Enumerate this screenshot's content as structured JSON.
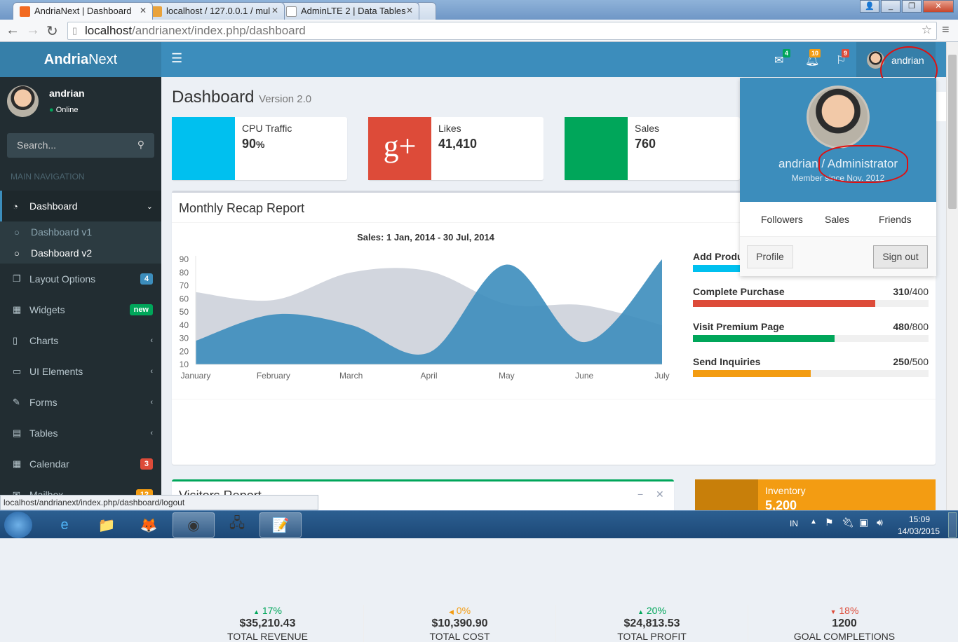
{
  "browser": {
    "tabs": [
      {
        "title": "AndriaNext | Dashboard",
        "active": true
      },
      {
        "title": "localhost / 127.0.0.1 / mul",
        "active": false
      },
      {
        "title": "AdminLTE 2 | Data Tables",
        "active": false
      }
    ],
    "url_host": "localhost",
    "url_path": "/andrianext/index.php/dashboard",
    "status_url": "localhost/andrianext/index.php/dashboard/logout"
  },
  "app": {
    "logo_bold": "Andria",
    "logo_light": "Next",
    "user": "andrian",
    "status": "Online",
    "notifications": {
      "messages": "4",
      "alerts": "10",
      "tasks": "9"
    }
  },
  "sidebar": {
    "search_placeholder": "Search...",
    "header": "MAIN NAVIGATION",
    "items": [
      {
        "label": "Dashboard",
        "icon": "dashboard-icon"
      },
      {
        "label": "Dashboard v1"
      },
      {
        "label": "Dashboard v2"
      },
      {
        "label": "Layout Options",
        "badge": "4"
      },
      {
        "label": "Widgets",
        "badge": "new"
      },
      {
        "label": "Charts"
      },
      {
        "label": "UI Elements"
      },
      {
        "label": "Forms"
      },
      {
        "label": "Tables"
      },
      {
        "label": "Calendar",
        "badge": "3"
      },
      {
        "label": "Mailbox",
        "badge": "12"
      }
    ]
  },
  "page": {
    "title": "Dashboard",
    "subtitle": "Version 2.0"
  },
  "info_boxes": [
    {
      "label": "CPU Traffic",
      "value": "90",
      "unit": "%",
      "color": "#00c0ef"
    },
    {
      "label": "Likes",
      "value": "41,410",
      "color": "#dd4b39"
    },
    {
      "label": "Sales",
      "value": "760",
      "color": "#00a65a"
    }
  ],
  "report": {
    "title": "Monthly Recap Report",
    "goals": [
      {
        "label": "Add Products to Cart",
        "color": "#00c0ef"
      },
      {
        "label": "Complete Purchase",
        "done": "310",
        "total": "/400",
        "fraction": 0.775,
        "color": "#dd4b39"
      },
      {
        "label": "Visit Premium Page",
        "done": "480",
        "total": "/800",
        "fraction": 0.6,
        "color": "#00a65a"
      },
      {
        "label": "Send Inquiries",
        "done": "250",
        "total": "/500",
        "fraction": 0.5,
        "color": "#f39c12"
      }
    ],
    "footer": [
      {
        "pct": "17%",
        "dir": "up",
        "amount": "$35,210.43",
        "caption": "TOTAL REVENUE",
        "color": "#00a65a"
      },
      {
        "pct": "0%",
        "dir": "left",
        "amount": "$10,390.90",
        "caption": "TOTAL COST",
        "color": "#f39c12"
      },
      {
        "pct": "20%",
        "dir": "up",
        "amount": "$24,813.53",
        "caption": "TOTAL PROFIT",
        "color": "#00a65a"
      },
      {
        "pct": "18%",
        "dir": "down",
        "amount": "1200",
        "caption": "GOAL COMPLETIONS",
        "color": "#dd4b39"
      }
    ]
  },
  "chart_data": {
    "type": "area",
    "title": "Sales: 1 Jan, 2014 - 30 Jul, 2014",
    "categories": [
      "January",
      "February",
      "March",
      "April",
      "May",
      "June",
      "July"
    ],
    "series": [
      {
        "values": [
          65,
          59,
          80,
          81,
          56,
          55,
          40
        ],
        "color": "#d2d6de"
      },
      {
        "values": [
          28,
          48,
          40,
          19,
          86,
          27,
          90
        ],
        "color": "#3c8dbc"
      }
    ],
    "ylim": [
      10,
      90
    ],
    "yticks": [
      "90",
      "80",
      "70",
      "60",
      "50",
      "40",
      "30",
      "20",
      "10"
    ],
    "grid": false
  },
  "visitors": {
    "title": "Visitors Report"
  },
  "inventory": {
    "label": "Inventory",
    "value": "5,200"
  },
  "user_dropdown": {
    "name_role": "andrian / Administrator",
    "member_since": "Member since Nov. 2012",
    "links": [
      "Followers",
      "Sales",
      "Friends"
    ],
    "profile": "Profile",
    "signout": "Sign out"
  },
  "taskbar": {
    "lang": "IN",
    "time": "15:09",
    "date": "14/03/2015"
  }
}
